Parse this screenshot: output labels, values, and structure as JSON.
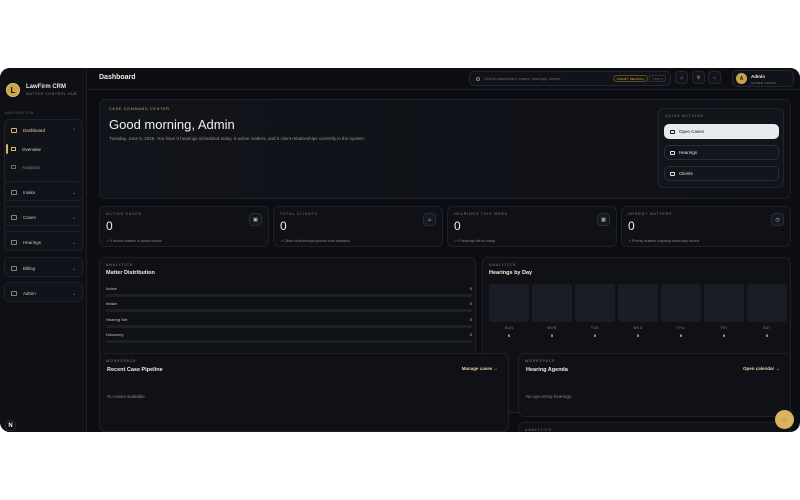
{
  "brand": {
    "name": "LawFirm CRM",
    "subtitle": "MATTER CONTROL HUB",
    "logo_letter": "L"
  },
  "sidebar": {
    "section_label": "NAVIGATION",
    "dashboard": {
      "label": "Dashboard",
      "children": [
        {
          "label": "Overview"
        },
        {
          "label": "Analytics"
        }
      ]
    },
    "items": [
      {
        "label": "Intake"
      },
      {
        "label": "Cases"
      },
      {
        "label": "Hearings"
      },
      {
        "label": "Billing"
      },
      {
        "label": "Admin"
      }
    ],
    "badge": "N"
  },
  "header": {
    "title": "Dashboard",
    "search_placeholder": "Search dashboard, cases, hearings, clients",
    "smart_search": "SMART SEARCH",
    "shortcut": "CTRL K",
    "user": {
      "name": "Admin",
      "role": "SUPER ADMIN",
      "initial": "A"
    }
  },
  "hero": {
    "eyebrow": "CASE COMMAND CENTER",
    "title": "Good morning, Admin",
    "description": "Tuesday, June 9, 2026. You have 0 hearings scheduled today, 0 active matters, and 0 client relationships currently in the system.",
    "quick_actions": {
      "label": "QUICK ACTIONS",
      "buttons": [
        {
          "label": "Open Cases"
        },
        {
          "label": "Hearings"
        },
        {
          "label": "Clients"
        }
      ]
    }
  },
  "stats": [
    {
      "label": "ACTIVE CASES",
      "value": "0",
      "note": "0 recent matters in active motion",
      "icon": "briefcase-icon"
    },
    {
      "label": "TOTAL CLIENTS",
      "value": "0",
      "note": "Client relationships synced from backend",
      "icon": "users-icon"
    },
    {
      "label": "HEARINGS THIS WEEK",
      "value": "0",
      "note": "0 hearings fall on today",
      "icon": "calendar-icon"
    },
    {
      "label": "URGENT MATTERS",
      "value": "0",
      "note": "Priority matters requiring same-day review",
      "icon": "alert-icon"
    }
  ],
  "matter_distribution": {
    "eyebrow": "ANALYTICS",
    "title": "Matter Distribution",
    "rows": [
      {
        "label": "Active",
        "value": "0",
        "fill": 0
      },
      {
        "label": "Intake",
        "value": "0",
        "fill": 0
      },
      {
        "label": "Hearing Set",
        "value": "0",
        "fill": 0
      },
      {
        "label": "Discovery",
        "value": "0",
        "fill": 0
      }
    ]
  },
  "hearings_by_day": {
    "eyebrow": "ANALYTICS",
    "title": "Hearings by Day",
    "days": [
      {
        "name": "SUN",
        "count": "0"
      },
      {
        "name": "MON",
        "count": "0"
      },
      {
        "name": "TUE",
        "count": "0"
      },
      {
        "name": "WED",
        "count": "0"
      },
      {
        "name": "THU",
        "count": "0"
      },
      {
        "name": "FRI",
        "count": "0"
      },
      {
        "name": "SAT",
        "count": "0"
      }
    ]
  },
  "pipeline": {
    "eyebrow": "WORKSPACE",
    "title": "Recent Case Pipeline",
    "link": "Manage cases →",
    "empty": "No cases available."
  },
  "agenda": {
    "eyebrow": "WORKSPACE",
    "title": "Hearing Agenda",
    "link": "Open calendar →",
    "empty": "No upcoming hearings."
  },
  "analytics_footer": {
    "eyebrow": "ANALYTICS"
  },
  "colors": {
    "accent": "#d9b45c",
    "background": "#0b0d12",
    "card": "#0f1117"
  }
}
